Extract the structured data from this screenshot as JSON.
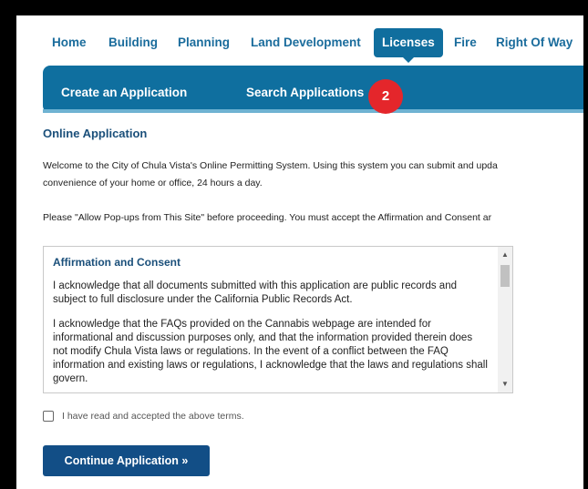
{
  "topnav": {
    "items": [
      {
        "label": "Home"
      },
      {
        "label": "Building"
      },
      {
        "label": "Planning"
      },
      {
        "label": "Land Development"
      },
      {
        "label": "Licenses"
      },
      {
        "label": "Fire"
      },
      {
        "label": "Right Of Way"
      }
    ],
    "active": "Licenses"
  },
  "subnav": {
    "items": [
      {
        "label": "Create an Application"
      },
      {
        "label": "Search Applications"
      }
    ]
  },
  "badge": {
    "text": "2"
  },
  "main": {
    "heading": "Online Application",
    "welcome_line1": "Welcome to the City of Chula Vista's Online Permitting System. Using this system you can submit and upda",
    "welcome_line2": "convenience of your home or office, 24 hours a day.",
    "popups_note": "Please \"Allow Pop-ups from This Site\" before proceeding. You must accept the Affirmation and Consent ar"
  },
  "terms": {
    "title": "Affirmation and Consent",
    "paragraph1": "I acknowledge that all documents submitted with this application are public records and subject to full disclosure under the California Public Records Act.",
    "paragraph2": "I acknowledge that the FAQs provided on the Cannabis webpage are intended for informational and discussion purposes only, and that the information provided therein does not modify Chula Vista laws or regulations. In the event of a conflict between the FAQ information and existing laws or regulations, I acknowledge that the laws and regulations shall govern."
  },
  "checkbox": {
    "label": "I have read and accepted the above terms.",
    "checked": false
  },
  "continue_button": {
    "label": "Continue Application »"
  },
  "colors": {
    "accent": "#0f6f9f",
    "nav_text": "#1a6c9c",
    "badge": "#e4262b",
    "button": "#124e86"
  }
}
